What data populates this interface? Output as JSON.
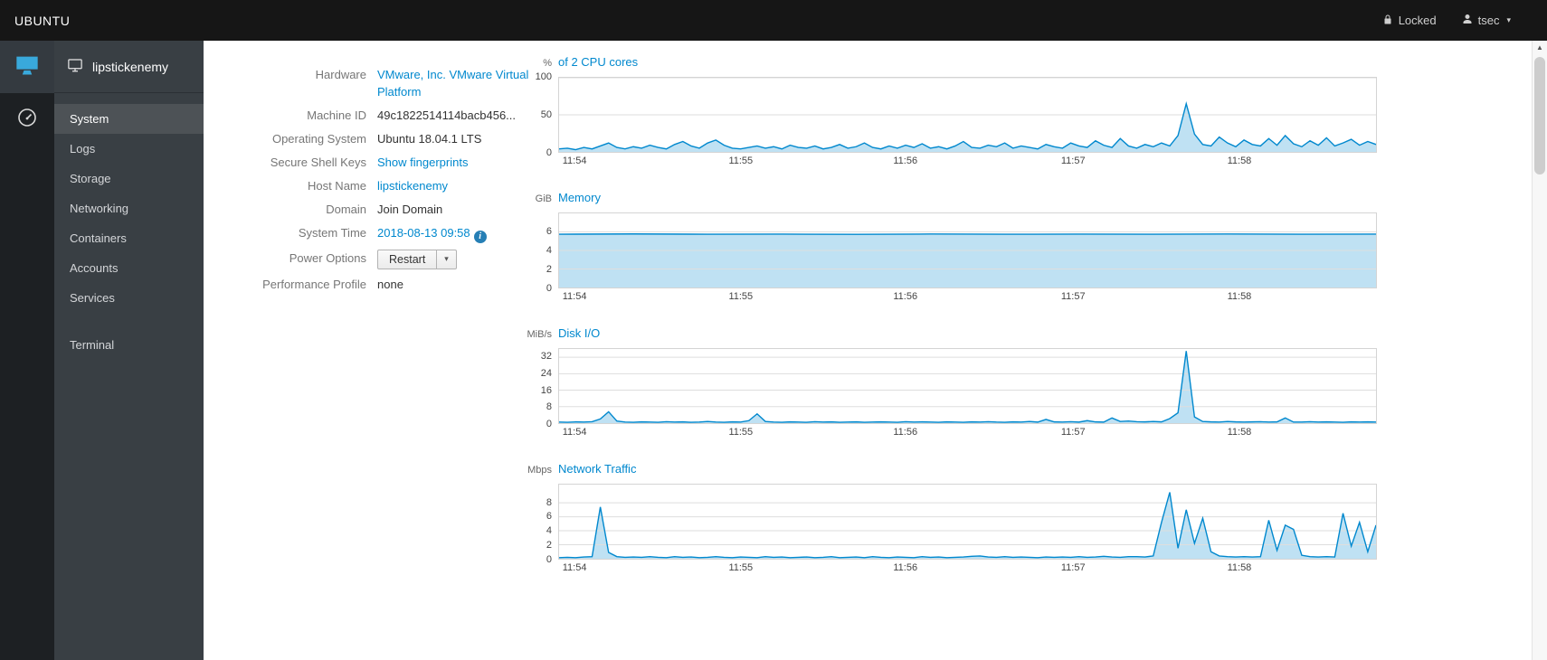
{
  "topbar": {
    "brand": "UBUNTU",
    "locked_label": "Locked",
    "user": "tsec"
  },
  "icons": {
    "caret_glyph": "▾",
    "user_caret_glyph": "▾",
    "info_glyph": "i",
    "scroll_up_glyph": "▲"
  },
  "colors": {
    "accent": "#0088ce",
    "sidebar_bg": "#393f44",
    "topbar_bg": "#161616",
    "chart_line": "#0088ce",
    "chart_fill": "rgba(0,136,206,0.25)"
  },
  "sidebar": {
    "host": "lipstickenemy",
    "items": [
      {
        "label": "System",
        "selected": true
      },
      {
        "label": "Logs"
      },
      {
        "label": "Storage"
      },
      {
        "label": "Networking"
      },
      {
        "label": "Containers"
      },
      {
        "label": "Accounts"
      },
      {
        "label": "Services"
      },
      {
        "label": "Terminal"
      }
    ]
  },
  "info": {
    "hardware_label": "Hardware",
    "hardware_value": "VMware, Inc. VMware Virtual Platform",
    "machine_id_label": "Machine ID",
    "machine_id_value": "49c1822514114bacb456...",
    "os_label": "Operating System",
    "os_value": "Ubuntu 18.04.1 LTS",
    "ssh_label": "Secure Shell Keys",
    "ssh_value": "Show fingerprints",
    "hostname_label": "Host Name",
    "hostname_value": "lipstickenemy",
    "domain_label": "Domain",
    "domain_value": "Join Domain",
    "time_label": "System Time",
    "time_value": "2018-08-13 09:58",
    "power_label": "Power Options",
    "power_value": "Restart",
    "profile_label": "Performance Profile",
    "profile_value": "none"
  },
  "chart_data": [
    {
      "type": "area",
      "unit": "%",
      "title": "of 2 CPU cores",
      "ylim": [
        0,
        100
      ],
      "y_ticks": [
        0,
        50,
        100
      ],
      "x_ticks": [
        {
          "label": "11:54",
          "pos": 0.02
        },
        {
          "label": "11:55",
          "pos": 0.223
        },
        {
          "label": "11:56",
          "pos": 0.424
        },
        {
          "label": "11:57",
          "pos": 0.629
        },
        {
          "label": "11:58",
          "pos": 0.832
        }
      ],
      "line": "#0088ce",
      "fill": "rgba(0,136,206,0.25)",
      "values": [
        4,
        5,
        3,
        6,
        4,
        8,
        12,
        6,
        4,
        7,
        5,
        9,
        6,
        4,
        10,
        14,
        8,
        5,
        12,
        16,
        9,
        5,
        4,
        6,
        8,
        5,
        7,
        4,
        9,
        6,
        5,
        8,
        4,
        6,
        10,
        5,
        7,
        12,
        6,
        4,
        8,
        5,
        9,
        6,
        11,
        5,
        7,
        4,
        8,
        14,
        6,
        5,
        9,
        7,
        12,
        5,
        8,
        6,
        4,
        10,
        7,
        5,
        12,
        8,
        6,
        15,
        9,
        6,
        18,
        8,
        5,
        10,
        7,
        12,
        8,
        22,
        65,
        24,
        10,
        8,
        20,
        12,
        7,
        16,
        10,
        8,
        18,
        9,
        22,
        11,
        7,
        15,
        9,
        19,
        8,
        12,
        17,
        9,
        14,
        10
      ]
    },
    {
      "type": "area",
      "unit": "GiB",
      "title": "Memory",
      "ylim": [
        0,
        8
      ],
      "y_ticks": [
        0,
        2,
        4,
        6
      ],
      "x_ticks": [
        {
          "label": "11:54",
          "pos": 0.02
        },
        {
          "label": "11:55",
          "pos": 0.223
        },
        {
          "label": "11:56",
          "pos": 0.424
        },
        {
          "label": "11:57",
          "pos": 0.629
        },
        {
          "label": "11:58",
          "pos": 0.832
        }
      ],
      "line": "#0088ce",
      "fill": "rgba(0,136,206,0.25)",
      "values": [
        5.75,
        5.78,
        5.75,
        5.76,
        5.74,
        5.77,
        5.75,
        5.76,
        5.75,
        5.77,
        5.75,
        5.76
      ]
    },
    {
      "type": "area",
      "unit": "MiB/s",
      "title": "Disk I/O",
      "ylim": [
        0,
        36
      ],
      "y_ticks": [
        0,
        8,
        16,
        24,
        32
      ],
      "x_ticks": [
        {
          "label": "11:54",
          "pos": 0.02
        },
        {
          "label": "11:55",
          "pos": 0.223
        },
        {
          "label": "11:56",
          "pos": 0.424
        },
        {
          "label": "11:57",
          "pos": 0.629
        },
        {
          "label": "11:58",
          "pos": 0.832
        }
      ],
      "line": "#0088ce",
      "fill": "rgba(0,136,206,0.25)",
      "values": [
        0.5,
        0.4,
        0.6,
        0.5,
        0.7,
        2.0,
        5.5,
        1.0,
        0.5,
        0.4,
        0.6,
        0.5,
        0.4,
        0.7,
        0.5,
        0.6,
        0.4,
        0.5,
        0.8,
        0.5,
        0.4,
        0.6,
        0.5,
        1.2,
        4.5,
        0.8,
        0.5,
        0.4,
        0.6,
        0.5,
        0.4,
        0.7,
        0.5,
        0.6,
        0.4,
        0.5,
        0.6,
        0.4,
        0.5,
        0.6,
        0.5,
        0.4,
        0.7,
        0.5,
        0.6,
        0.5,
        0.4,
        0.6,
        0.5,
        0.4,
        0.6,
        0.5,
        0.7,
        0.5,
        0.4,
        0.6,
        0.5,
        0.8,
        0.5,
        1.8,
        0.6,
        0.5,
        0.7,
        0.5,
        1.2,
        0.6,
        0.5,
        2.5,
        0.8,
        1.0,
        0.7,
        0.6,
        0.8,
        0.6,
        2.2,
        5.0,
        35,
        3.0,
        0.8,
        0.6,
        0.5,
        0.8,
        0.6,
        0.5,
        0.6,
        0.7,
        0.5,
        0.6,
        2.5,
        0.5,
        0.5,
        0.7,
        0.5,
        0.6,
        0.5,
        0.4,
        0.6,
        0.5,
        0.6,
        0.5
      ]
    },
    {
      "type": "area",
      "unit": "Mbps",
      "title": "Network Traffic",
      "ylim": [
        0,
        10.6
      ],
      "y_ticks": [
        0,
        2,
        4,
        6,
        8
      ],
      "x_ticks": [
        {
          "label": "11:54",
          "pos": 0.02
        },
        {
          "label": "11:55",
          "pos": 0.223
        },
        {
          "label": "11:56",
          "pos": 0.424
        },
        {
          "label": "11:57",
          "pos": 0.629
        },
        {
          "label": "11:58",
          "pos": 0.832
        }
      ],
      "line": "#0088ce",
      "fill": "rgba(0,136,206,0.25)",
      "values": [
        0.15,
        0.2,
        0.15,
        0.25,
        0.3,
        7.4,
        0.9,
        0.3,
        0.2,
        0.25,
        0.2,
        0.3,
        0.2,
        0.15,
        0.3,
        0.2,
        0.25,
        0.15,
        0.2,
        0.3,
        0.2,
        0.15,
        0.25,
        0.2,
        0.15,
        0.3,
        0.2,
        0.25,
        0.15,
        0.2,
        0.25,
        0.15,
        0.2,
        0.3,
        0.15,
        0.2,
        0.25,
        0.15,
        0.3,
        0.2,
        0.15,
        0.25,
        0.2,
        0.15,
        0.3,
        0.2,
        0.25,
        0.15,
        0.2,
        0.25,
        0.35,
        0.4,
        0.25,
        0.2,
        0.3,
        0.2,
        0.25,
        0.2,
        0.15,
        0.25,
        0.2,
        0.25,
        0.2,
        0.3,
        0.2,
        0.25,
        0.35,
        0.25,
        0.2,
        0.3,
        0.3,
        0.25,
        0.4,
        5.2,
        9.5,
        1.5,
        7.0,
        2.2,
        5.8,
        1.0,
        0.4,
        0.3,
        0.25,
        0.3,
        0.25,
        0.3,
        5.5,
        1.2,
        4.8,
        4.2,
        0.5,
        0.3,
        0.25,
        0.3,
        0.25,
        6.5,
        1.8,
        5.2,
        1.0,
        4.8
      ]
    }
  ]
}
